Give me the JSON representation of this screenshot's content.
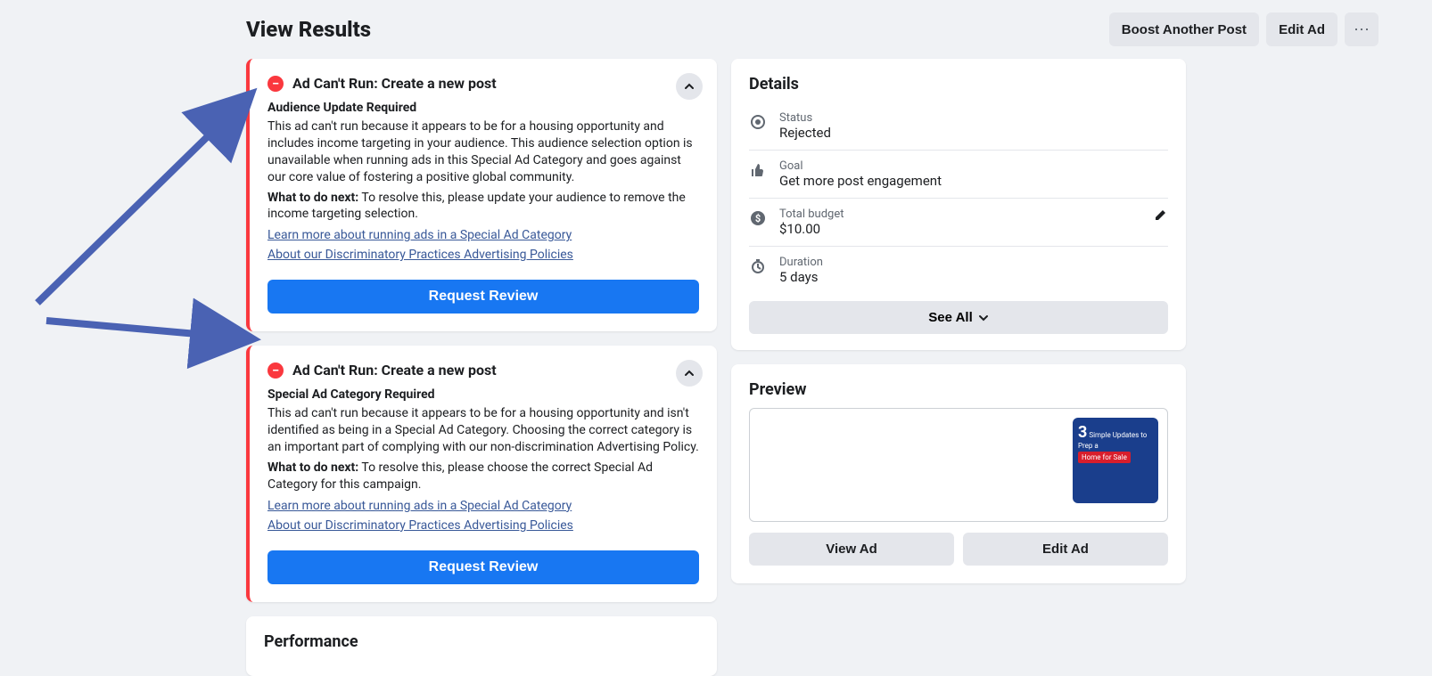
{
  "header": {
    "title": "View Results",
    "boost": "Boost Another Post",
    "edit": "Edit Ad"
  },
  "alerts": [
    {
      "title": "Ad Can't Run: Create a new post",
      "subtitle": "Audience Update Required",
      "body": "This ad can't run because it appears to be for a housing opportunity and includes income targeting in your audience. This audience selection option is unavailable when running ads in this Special Ad Category and goes against our core value of fostering a positive global community.",
      "next_label": "What to do next:",
      "next_body": "To resolve this, please update your audience to remove the income targeting selection.",
      "link1": "Learn more about running ads in a Special Ad Category",
      "link2": "About our Discriminatory Practices Advertising Policies",
      "cta": "Request Review"
    },
    {
      "title": "Ad Can't Run: Create a new post",
      "subtitle": "Special Ad Category Required",
      "body": "This ad can't run because it appears to be for a housing opportunity and isn't identified as being in a Special Ad Category. Choosing the correct category is an important part of complying with our non-discrimination Advertising Policy.",
      "next_label": "What to do next:",
      "next_body": "To resolve this, please choose the correct Special Ad Category for this campaign.",
      "link1": "Learn more about running ads in a Special Ad Category",
      "link2": "About our Discriminatory Practices Advertising Policies",
      "cta": "Request Review"
    }
  ],
  "performance": {
    "title": "Performance"
  },
  "details": {
    "title": "Details",
    "status_label": "Status",
    "status_value": "Rejected",
    "goal_label": "Goal",
    "goal_value": "Get more post engagement",
    "budget_label": "Total budget",
    "budget_value": "$10.00",
    "duration_label": "Duration",
    "duration_value": "5 days",
    "see_all": "See All"
  },
  "preview": {
    "title": "Preview",
    "view": "View Ad",
    "edit": "Edit Ad",
    "thumb_num": "3",
    "thumb_line": "Simple Updates to Prep a",
    "thumb_tag": "Home for Sale"
  }
}
